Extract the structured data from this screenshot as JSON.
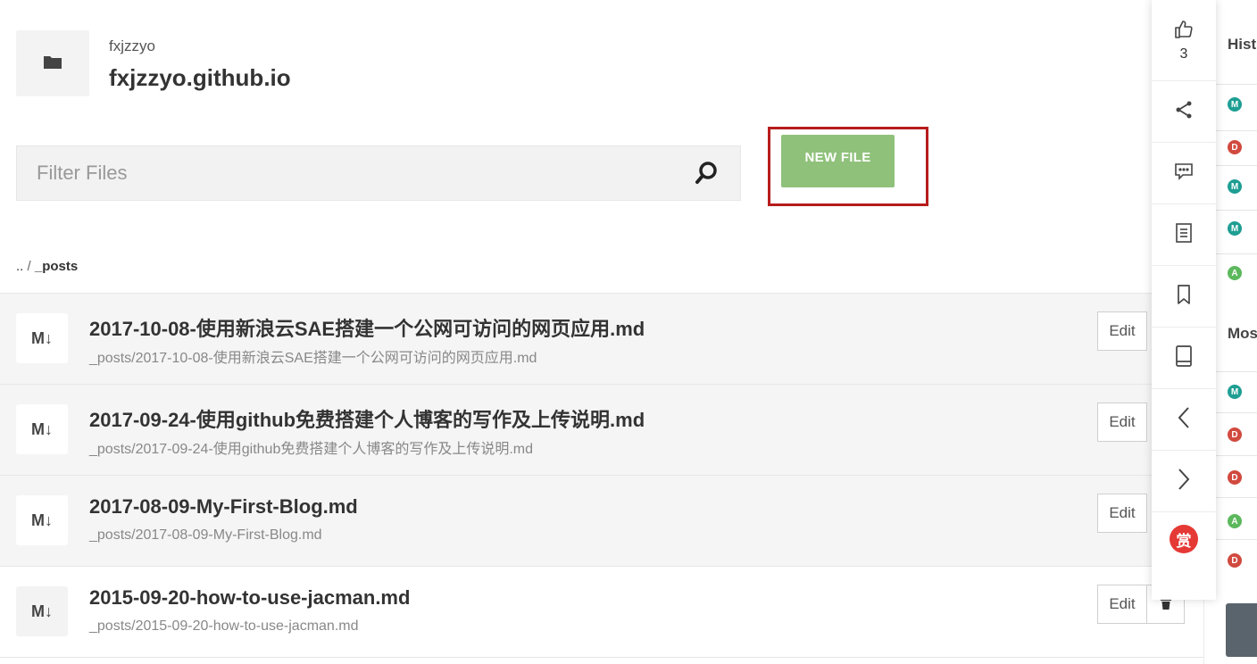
{
  "repo": {
    "owner": "fxjzzyo",
    "name": "fxjzzyo.github.io",
    "icon": "folder-icon"
  },
  "filter": {
    "placeholder": "Filter Files",
    "value": ""
  },
  "new_file_label": "NEW FILE",
  "breadcrumb": {
    "parent": "..",
    "separator": "/",
    "dir": "_posts"
  },
  "files": [
    {
      "title": "2017-10-08-使用新浪云SAE搭建一个公网可访问的网页应用.md",
      "path": "_posts/2017-10-08-使用新浪云SAE搭建一个公网可访问的网页应用.md",
      "badge": "M↓",
      "edit_label": "Edit"
    },
    {
      "title": "2017-09-24-使用github免费搭建个人博客的写作及上传说明.md",
      "path": "_posts/2017-09-24-使用github免费搭建个人博客的写作及上传说明.md",
      "badge": "M↓",
      "edit_label": "Edit"
    },
    {
      "title": "2017-08-09-My-First-Blog.md",
      "path": "_posts/2017-08-09-My-First-Blog.md",
      "badge": "M↓",
      "edit_label": "Edit"
    },
    {
      "title": "2015-09-20-how-to-use-jacman.md",
      "path": "_posts/2015-09-20-how-to-use-jacman.md",
      "badge": "M↓",
      "edit_label": "Edit"
    }
  ],
  "toolbar": {
    "like_count": "3",
    "reward_label": "赏",
    "icons": [
      "thumbs-up-icon",
      "share-icon",
      "comment-icon",
      "document-icon",
      "bookmark-icon",
      "tablet-icon",
      "chevron-left-icon",
      "chevron-right-icon",
      "reward-icon"
    ]
  },
  "history": {
    "heading": "Hist",
    "most_heading": "Mos",
    "entries_top": [
      "M",
      "D",
      "M",
      "M",
      "A"
    ],
    "entries_bottom": [
      "M",
      "D",
      "D",
      "A",
      "D"
    ]
  },
  "colors": {
    "new_file_button": "#8fc17a",
    "highlight": "#b71c1c",
    "status_modified": "#1e9e93",
    "status_deleted": "#d14a3f",
    "status_added": "#5cb85c"
  }
}
